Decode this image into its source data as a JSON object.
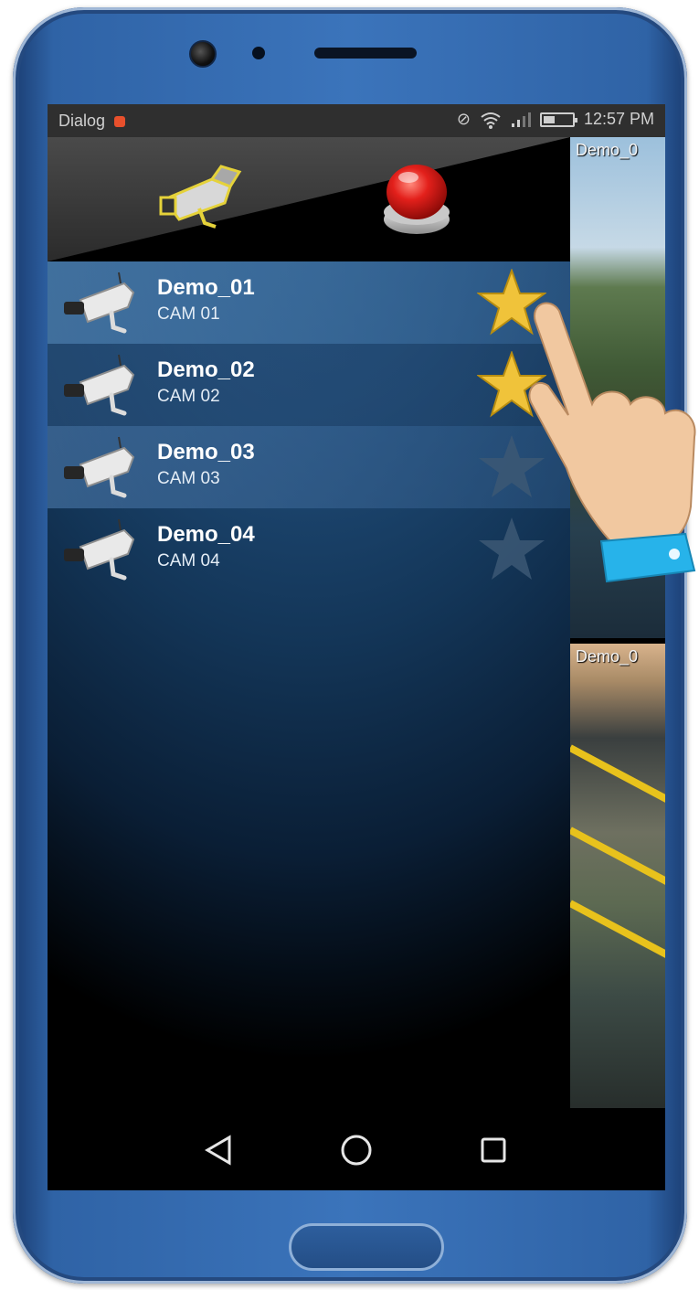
{
  "status_bar": {
    "carrier": "Dialog",
    "time": "12:57 PM"
  },
  "cameras": [
    {
      "name": "Demo_01",
      "id": "CAM 01",
      "favorite": true
    },
    {
      "name": "Demo_02",
      "id": "CAM 02",
      "favorite": true
    },
    {
      "name": "Demo_03",
      "id": "CAM 03",
      "favorite": false
    },
    {
      "name": "Demo_04",
      "id": "CAM 04",
      "favorite": false
    }
  ],
  "video_tiles": [
    {
      "label": "Demo_0"
    },
    {
      "label": "Demo_0"
    }
  ],
  "colors": {
    "star_active": "#f0c33a",
    "star_inactive": "#3c5874",
    "record_button": "#e3201b",
    "phone_body": "#3b74bb"
  },
  "icons": {
    "header_camera": "cctv-camera-icon",
    "record": "record-button-icon",
    "nav_back": "back-triangle-icon",
    "nav_home": "home-circle-icon",
    "nav_recents": "recents-square-icon"
  }
}
